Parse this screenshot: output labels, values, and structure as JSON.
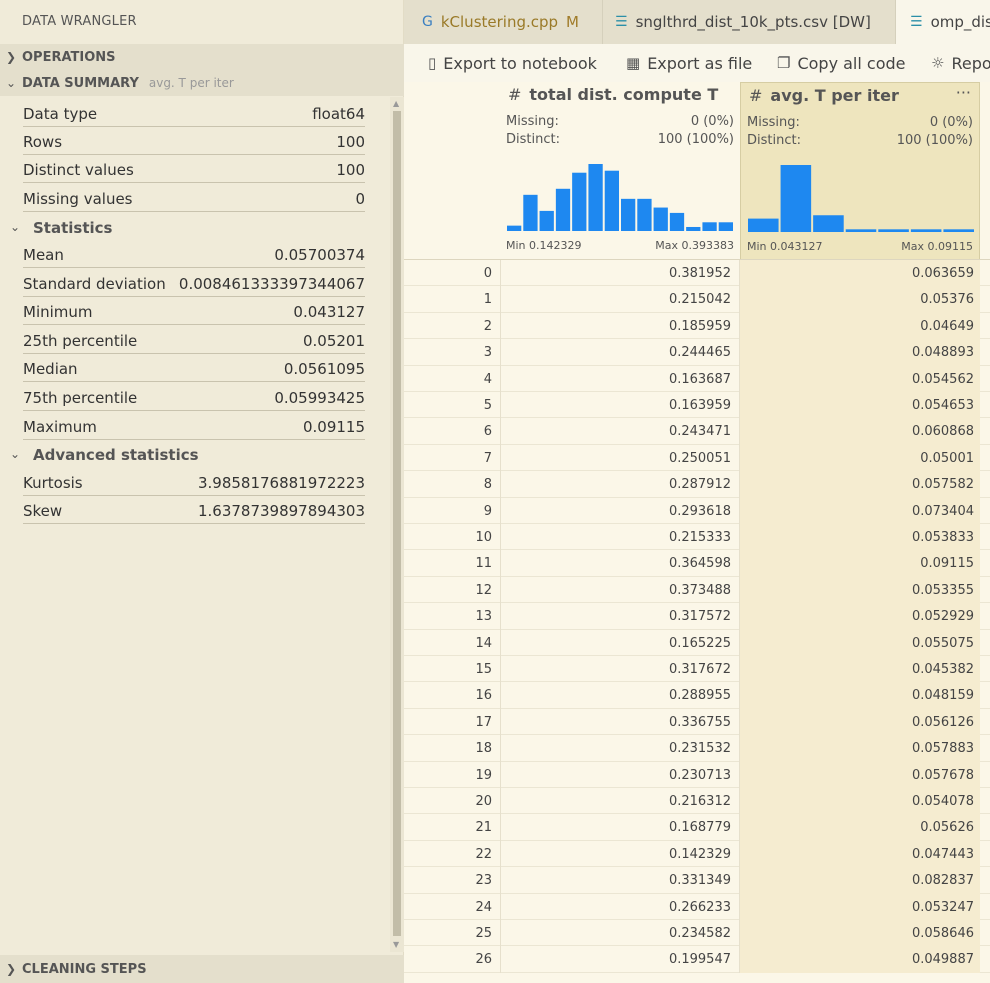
{
  "panel_title": "DATA WRANGLER",
  "operations_label": "OPERATIONS",
  "data_summary": {
    "label": "DATA SUMMARY",
    "column": "avg. T per iter",
    "basic": [
      {
        "key": "Data type",
        "value": "float64"
      },
      {
        "key": "Rows",
        "value": "100"
      },
      {
        "key": "Distinct values",
        "value": "100"
      },
      {
        "key": "Missing values",
        "value": "0"
      }
    ],
    "statistics_label": "Statistics",
    "statistics": [
      {
        "key": "Mean",
        "value": "0.05700374"
      },
      {
        "key": "Standard deviation",
        "value": "0.008461333397344067"
      },
      {
        "key": "Minimum",
        "value": "0.043127"
      },
      {
        "key": "25th percentile",
        "value": "0.05201"
      },
      {
        "key": "Median",
        "value": "0.0561095"
      },
      {
        "key": "75th percentile",
        "value": "0.05993425"
      },
      {
        "key": "Maximum",
        "value": "0.09115"
      }
    ],
    "advanced_label": "Advanced statistics",
    "advanced": [
      {
        "key": "Kurtosis",
        "value": "3.9858176881972223"
      },
      {
        "key": "Skew",
        "value": "1.6378739897894303"
      }
    ]
  },
  "cleaning_steps_label": "CLEANING STEPS",
  "tabs": [
    {
      "label": "kClustering.cpp",
      "badge": "M"
    },
    {
      "label": "snglthrd_dist_10k_pts.csv [DW]"
    },
    {
      "label": "omp_dis"
    }
  ],
  "toolbar": {
    "export_notebook": "Export to notebook",
    "export_file": "Export as file",
    "copy_code": "Copy all code",
    "report": "Repo"
  },
  "columns": [
    {
      "name": "total dist. compute T",
      "missing_label": "Missing:",
      "missing": "0 (0%)",
      "distinct_label": "Distinct:",
      "distinct": "100 (100%)",
      "min_label": "Min 0.142329",
      "max_label": "Max 0.393383",
      "histogram": [
        0.08,
        0.54,
        0.3,
        0.63,
        0.87,
        1.0,
        0.9,
        0.48,
        0.48,
        0.35,
        0.27,
        0.06,
        0.13,
        0.13
      ],
      "more": ""
    },
    {
      "name": "avg. T per iter",
      "missing_label": "Missing:",
      "missing": "0 (0%)",
      "distinct_label": "Distinct:",
      "distinct": "100 (100%)",
      "min_label": "Min 0.043127",
      "max_label": "Max 0.09115",
      "histogram": [
        0.2,
        1.0,
        0.25,
        0.04,
        0.04,
        0.04,
        0.04
      ],
      "more": "···"
    }
  ],
  "rows": [
    {
      "i": "0",
      "a": "0.381952",
      "b": "0.063659"
    },
    {
      "i": "1",
      "a": "0.215042",
      "b": "0.05376"
    },
    {
      "i": "2",
      "a": "0.185959",
      "b": "0.04649"
    },
    {
      "i": "3",
      "a": "0.244465",
      "b": "0.048893"
    },
    {
      "i": "4",
      "a": "0.163687",
      "b": "0.054562"
    },
    {
      "i": "5",
      "a": "0.163959",
      "b": "0.054653"
    },
    {
      "i": "6",
      "a": "0.243471",
      "b": "0.060868"
    },
    {
      "i": "7",
      "a": "0.250051",
      "b": "0.05001"
    },
    {
      "i": "8",
      "a": "0.287912",
      "b": "0.057582"
    },
    {
      "i": "9",
      "a": "0.293618",
      "b": "0.073404"
    },
    {
      "i": "10",
      "a": "0.215333",
      "b": "0.053833"
    },
    {
      "i": "11",
      "a": "0.364598",
      "b": "0.09115"
    },
    {
      "i": "12",
      "a": "0.373488",
      "b": "0.053355"
    },
    {
      "i": "13",
      "a": "0.317572",
      "b": "0.052929"
    },
    {
      "i": "14",
      "a": "0.165225",
      "b": "0.055075"
    },
    {
      "i": "15",
      "a": "0.317672",
      "b": "0.045382"
    },
    {
      "i": "16",
      "a": "0.288955",
      "b": "0.048159"
    },
    {
      "i": "17",
      "a": "0.336755",
      "b": "0.056126"
    },
    {
      "i": "18",
      "a": "0.231532",
      "b": "0.057883"
    },
    {
      "i": "19",
      "a": "0.230713",
      "b": "0.057678"
    },
    {
      "i": "20",
      "a": "0.216312",
      "b": "0.054078"
    },
    {
      "i": "21",
      "a": "0.168779",
      "b": "0.05626"
    },
    {
      "i": "22",
      "a": "0.142329",
      "b": "0.047443"
    },
    {
      "i": "23",
      "a": "0.331349",
      "b": "0.082837"
    },
    {
      "i": "24",
      "a": "0.266233",
      "b": "0.053247"
    },
    {
      "i": "25",
      "a": "0.234582",
      "b": "0.058646"
    },
    {
      "i": "26",
      "a": "0.199547",
      "b": "0.049887"
    }
  ],
  "colors": {
    "bar": "#1e88f0",
    "selected_column": "#eee5be"
  }
}
